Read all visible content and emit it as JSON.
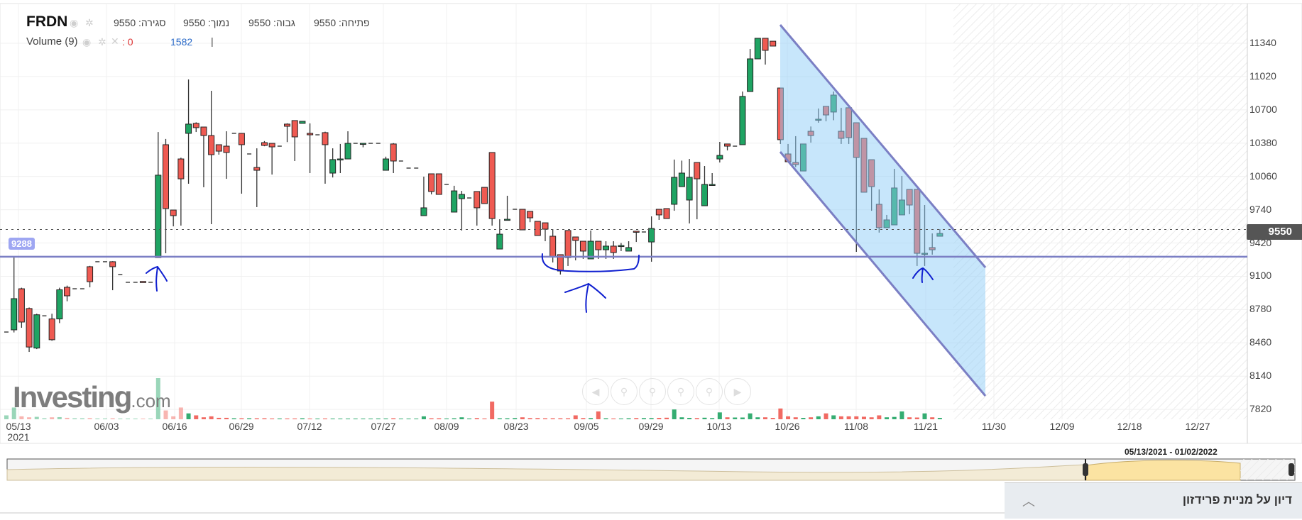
{
  "header": {
    "ticker": "FRDN",
    "close": "סגירה: 9550",
    "low": "נמוך: 9550",
    "high": "גבוה: 9550",
    "open": "פתיחה: 9550",
    "volume_label": "Volume (9)",
    "volume_value_1": ": 0",
    "volume_value_2": "1582",
    "volume_sep": "|"
  },
  "icons": {
    "eye": "eye-icon",
    "gear": "gear-icon",
    "close": "close-icon"
  },
  "watermark": {
    "brand": "Investing",
    "suffix": ".com"
  },
  "navigator": {
    "range": "05/13/2021 - 01/02/2022"
  },
  "discussion_panel": {
    "title": "דיון על מניית פרידזון"
  },
  "colors": {
    "up": "#1fa463",
    "down": "#ef5a52",
    "line": "#7b7fc4",
    "channel": "#9fd2f7",
    "annotation": "#1020d0"
  },
  "chart_data": {
    "type": "candlestick",
    "title": "FRDN",
    "ylim": [
      7700,
      11500
    ],
    "y_ticks": [
      "11340",
      "11020",
      "10700",
      "10380",
      "10060",
      "9740",
      "9420",
      "9100",
      "8780",
      "8460",
      "8140",
      "7820"
    ],
    "x_ticks": [
      "05/13",
      "06/03",
      "06/16",
      "06/29",
      "07/12",
      "07/27",
      "08/09",
      "08/23",
      "09/05",
      "09/29",
      "10/13",
      "10/26",
      "11/08",
      "11/21",
      "11/30",
      "12/09",
      "12/18",
      "12/27"
    ],
    "x_year": "2021",
    "last_price": "9550",
    "horizontal_line": {
      "value": 9288,
      "label": "9288"
    },
    "ohlc": [
      [
        8564,
        8564,
        8564,
        8564
      ],
      [
        8585,
        9280,
        8560,
        8885
      ],
      [
        8980,
        8990,
        8605,
        8660
      ],
      [
        8790,
        8800,
        8373,
        8420
      ],
      [
        8410,
        8740,
        8400,
        8730
      ],
      [
        8720,
        8720,
        8720,
        8720
      ],
      [
        8690,
        8740,
        8480,
        8490
      ],
      [
        8690,
        8990,
        8650,
        8970
      ],
      [
        8994,
        9010,
        8860,
        8912
      ],
      [
        8980,
        8980,
        8980,
        8980
      ],
      [
        8980,
        8980,
        8980,
        8980
      ],
      [
        9192,
        9200,
        8994,
        9048
      ],
      [
        9240,
        9240,
        9240,
        9240
      ],
      [
        9240,
        9240,
        9240,
        9240
      ],
      [
        9240,
        9245,
        8966,
        9192
      ],
      [
        9117,
        9117,
        9117,
        9117
      ],
      [
        9042,
        9042,
        9042,
        9042
      ],
      [
        9042,
        9042,
        9042,
        9042
      ],
      [
        9050,
        9050,
        9040,
        9046
      ],
      [
        9042,
        9042,
        9042,
        9042
      ],
      [
        9280,
        10487,
        9280,
        10072
      ],
      [
        10365,
        10420,
        9321,
        9751
      ],
      [
        9737,
        9737,
        9580,
        9683
      ],
      [
        10228,
        10240,
        9587,
        10037
      ],
      [
        10474,
        10992,
        9990,
        10563
      ],
      [
        10570,
        10580,
        10487,
        10529
      ],
      [
        10535,
        10535,
        9956,
        10453
      ],
      [
        10453,
        10883,
        9601,
        10269
      ],
      [
        10365,
        10365,
        10269,
        10303
      ],
      [
        10351,
        10494,
        10037,
        10290
      ],
      [
        10474,
        10474,
        10474,
        10474
      ],
      [
        10474,
        10474,
        9894,
        10365
      ],
      [
        10276,
        10276,
        10276,
        10276
      ],
      [
        10146,
        10330,
        9765,
        10119
      ],
      [
        10385,
        10400,
        10350,
        10358
      ],
      [
        10378,
        10378,
        10078,
        10344
      ],
      [
        10351,
        10351,
        10351,
        10351
      ],
      [
        10563,
        10570,
        10390,
        10542
      ],
      [
        10597,
        10600,
        10208,
        10440
      ],
      [
        10570,
        10590,
        10570,
        10590
      ],
      [
        10474,
        10570,
        10092,
        10460
      ],
      [
        10460,
        10460,
        10460,
        10460
      ],
      [
        10481,
        10490,
        9990,
        10365
      ],
      [
        10092,
        10330,
        10050,
        10222
      ],
      [
        10228,
        10372,
        10092,
        10228
      ],
      [
        10228,
        10494,
        10228,
        10378
      ],
      [
        10378,
        10378,
        10378,
        10378
      ],
      [
        10378,
        10378,
        10340,
        10378
      ],
      [
        10378,
        10378,
        10378,
        10378
      ],
      [
        10378,
        10378,
        10378,
        10378
      ],
      [
        10119,
        10250,
        10119,
        10228
      ],
      [
        10372,
        10380,
        10092,
        10208
      ],
      [
        10208,
        10208,
        10208,
        10208
      ],
      [
        10140,
        10140,
        10140,
        10140
      ],
      [
        10140,
        10140,
        10140,
        10140
      ],
      [
        9683,
        10058,
        9683,
        9758
      ],
      [
        10085,
        10085,
        9887,
        9915
      ],
      [
        10085,
        10085,
        9887,
        9887
      ],
      [
        9983,
        9983,
        9983,
        9983
      ],
      [
        9717,
        9970,
        9717,
        9921
      ],
      [
        9846,
        9921,
        9540,
        9887
      ],
      [
        9853,
        9853,
        9853,
        9853
      ],
      [
        9915,
        9915,
        9587,
        9758
      ],
      [
        9955,
        9955,
        9799,
        9799
      ],
      [
        10290,
        10290,
        9587,
        9655
      ],
      [
        9362,
        9648,
        9362,
        9505
      ],
      [
        9648,
        9874,
        9648,
        9648
      ],
      [
        9744,
        9744,
        9744,
        9744
      ],
      [
        9744,
        9744,
        9546,
        9546
      ],
      [
        9724,
        9724,
        9620,
        9662
      ],
      [
        9628,
        9628,
        9492,
        9492
      ],
      [
        9614,
        9614,
        9437,
        9553
      ],
      [
        9485,
        9553,
        9233,
        9287
      ],
      [
        9308,
        9308,
        9117,
        9151
      ],
      [
        9540,
        9540,
        9199,
        9280
      ],
      [
        9478,
        9478,
        9253,
        9444
      ],
      [
        9437,
        9437,
        9267,
        9342
      ],
      [
        9267,
        9540,
        9267,
        9437
      ],
      [
        9437,
        9437,
        9267,
        9355
      ],
      [
        9355,
        9437,
        9267,
        9390
      ],
      [
        9390,
        9437,
        9267,
        9328
      ],
      [
        9396,
        9420,
        9342,
        9396
      ],
      [
        9342,
        9437,
        9342,
        9376
      ],
      [
        9533,
        9533,
        9430,
        9526
      ],
      [
        9526,
        9526,
        9526,
        9526
      ],
      [
        9430,
        9676,
        9240,
        9560
      ],
      [
        9744,
        9744,
        9642,
        9690
      ],
      [
        9751,
        9751,
        9655,
        9655
      ],
      [
        9792,
        10222,
        9730,
        10051
      ],
      [
        9962,
        10212,
        9962,
        10092
      ],
      [
        9833,
        10228,
        9608,
        10051
      ],
      [
        10194,
        10194,
        9648,
        10037
      ],
      [
        9778,
        10160,
        9778,
        9983
      ],
      [
        9983,
        10092,
        9983,
        9983
      ],
      [
        10228,
        10392,
        10194,
        10262
      ],
      [
        10372,
        10372,
        10310,
        10351
      ],
      [
        10351,
        10351,
        10351,
        10351
      ],
      [
        10365,
        10876,
        10365,
        10829
      ],
      [
        10876,
        11285,
        10876,
        11190
      ],
      [
        11190,
        11388,
        11190,
        11388
      ],
      [
        11388,
        11388,
        11135,
        11272
      ],
      [
        11360,
        11360,
        11313,
        11313
      ],
      [
        10910,
        10910,
        10372,
        10413
      ],
      [
        10276,
        10372,
        10201,
        10201
      ],
      [
        10194,
        10447,
        10150,
        10174
      ],
      [
        10112,
        10372,
        10112,
        10372
      ],
      [
        10494,
        10540,
        10385,
        10453
      ],
      [
        10610,
        10713,
        10576,
        10610
      ],
      [
        10733,
        10733,
        10590,
        10651
      ],
      [
        10679,
        10876,
        10600,
        10842
      ],
      [
        10494,
        10720,
        10372,
        10426
      ],
      [
        10720,
        10720,
        10372,
        10433
      ],
      [
        10576,
        10576,
        9335,
        10242
      ],
      [
        10426,
        10426,
        9908,
        9908
      ],
      [
        10221,
        10221,
        9730,
        9962
      ],
      [
        9792,
        9935,
        9520,
        9567
      ],
      [
        9567,
        9690,
        9567,
        9642
      ],
      [
        9594,
        10133,
        9594,
        9949
      ],
      [
        9690,
        10065,
        9690,
        9833
      ],
      [
        9935,
        9935,
        9697,
        9785
      ],
      [
        9935,
        9935,
        9199,
        9321
      ],
      [
        9321,
        9785,
        9199,
        9321
      ],
      [
        9376,
        9512,
        9308,
        9355
      ],
      [
        9485,
        9553,
        9485,
        9512
      ]
    ],
    "volume": [
      40,
      120,
      30,
      20,
      25,
      10,
      20,
      22,
      15,
      10,
      10,
      12,
      8,
      8,
      10,
      5,
      5,
      5,
      5,
      5,
      420,
      90,
      30,
      120,
      60,
      40,
      20,
      30,
      15,
      15,
      10,
      10,
      10,
      10,
      10,
      8,
      8,
      8,
      8,
      10,
      6,
      6,
      8,
      6,
      6,
      6,
      6,
      6,
      6,
      8,
      8,
      10,
      6,
      6,
      6,
      30,
      10,
      10,
      8,
      10,
      20,
      8,
      12,
      8,
      180,
      10,
      10,
      12,
      20,
      12,
      12,
      10,
      10,
      10,
      10,
      40,
      12,
      12,
      80,
      10,
      8,
      8,
      10,
      12,
      12,
      12,
      14,
      16,
      100,
      20,
      14,
      12,
      16,
      12,
      70,
      20,
      18,
      18,
      60,
      20,
      20,
      14,
      110,
      30,
      20,
      14,
      20,
      30,
      60,
      40,
      30,
      30,
      30,
      26,
      20,
      40,
      20,
      24,
      80,
      20,
      18,
      60,
      20,
      14
    ]
  }
}
